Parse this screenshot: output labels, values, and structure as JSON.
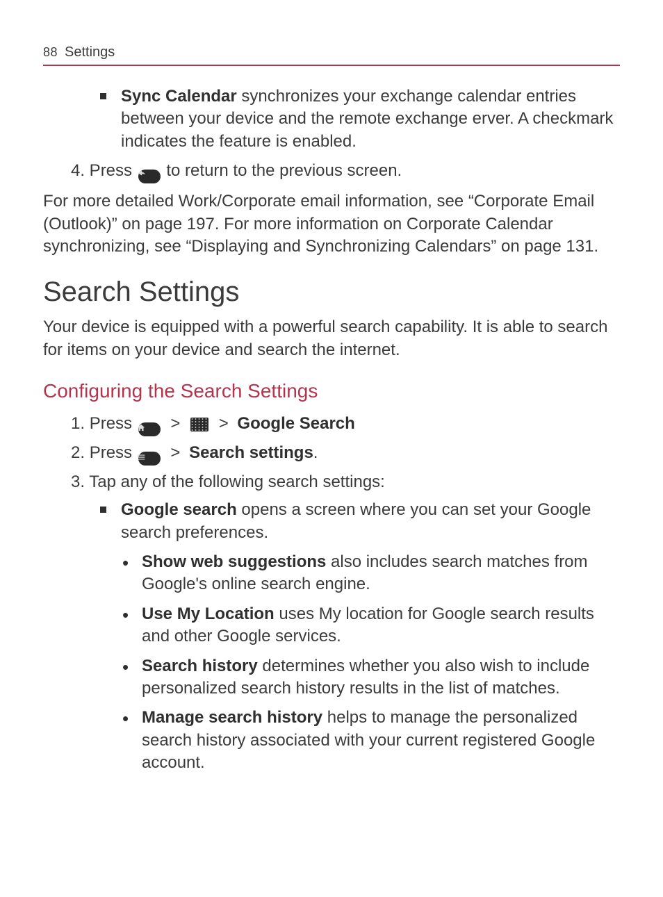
{
  "header": {
    "page_number": "88",
    "section": "Settings"
  },
  "continuation": {
    "sync_calendar_bold": "Sync Calendar",
    "sync_calendar_rest": " synchronizes your exchange calendar entries between your device and the remote exchange erver. A checkmark indicates the feature is enabled.",
    "step4_prefix": "4. Press ",
    "step4_suffix": " to return to the previous screen.",
    "followup": "For more detailed Work/Corporate email information, see “Corporate Email (Outlook)” on page 197. For more information on Corporate Calendar synchronizing, see “Displaying and Synchronizing Calendars” on page 131."
  },
  "section_title": "Search Settings",
  "section_intro": "Your device is equipped with a powerful search capability. It is able to search for items on your device and search the internet.",
  "subheading": "Configuring the Search Settings",
  "steps": {
    "s1_num": "1. ",
    "s1_a": "Press ",
    "s1_b": "Google Search",
    "s2_num": "2. ",
    "s2_a": "Press ",
    "s2_b": "Search settings",
    "s2_c": ".",
    "s3_num": "3. ",
    "s3_a": "Tap any of the following search settings:"
  },
  "google_search": {
    "label": "Google search",
    "rest": " opens a screen where you can set your Google search preferences."
  },
  "sub_options": [
    {
      "label": "Show web suggestions",
      "rest": " also includes search matches from Google's online search engine."
    },
    {
      "label": "Use My Location",
      "rest": " uses My location for Google search results and other Google services."
    },
    {
      "label": "Search history",
      "rest": " determines whether you also wish to include personalized search history results in the list of matches."
    },
    {
      "label": "Manage search history",
      "rest": " helps to manage the personalized search history associated with your current registered Google account."
    }
  ],
  "glyphs": {
    "gt": ">"
  }
}
